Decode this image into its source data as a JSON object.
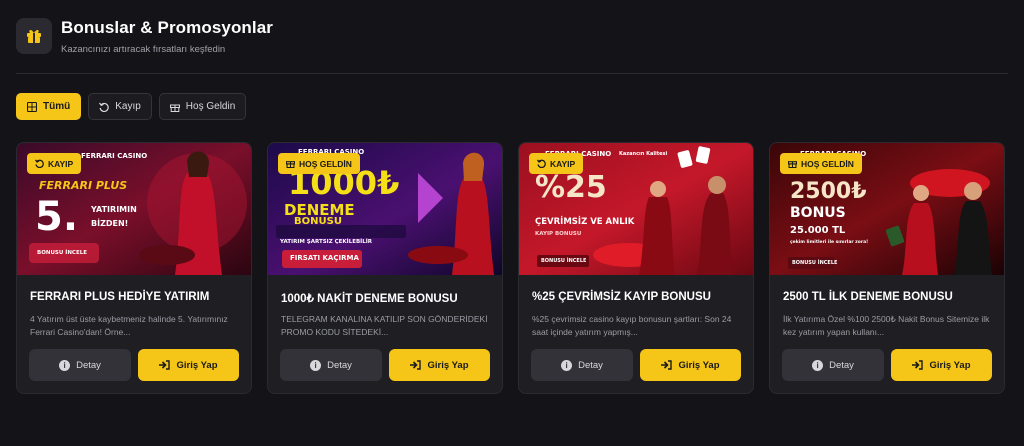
{
  "header": {
    "icon": "gift-icon",
    "title": "Bonuslar & Promosyonlar",
    "subtitle": "Kazancınızı artıracak fırsatları keşfedin"
  },
  "filters": [
    {
      "label": "Tümü",
      "icon": "grid-icon",
      "active": true
    },
    {
      "label": "Kayıp",
      "icon": "refresh-icon",
      "active": false
    },
    {
      "label": "Hoş Geldin",
      "icon": "gift-icon",
      "active": false
    }
  ],
  "colors": {
    "accent": "#f5c518",
    "background": "#141418",
    "card": "#1e1e23"
  },
  "cards": [
    {
      "badge": "KAYIP",
      "badge_icon": "refresh-icon",
      "title": "FERRARI PLUS HEDİYE YATIRIM",
      "description": "4 Yatırım üst üste kaybetmeniz halinde 5. Yatırımınız Ferrari Casino'dan! Örne...",
      "detail_label": "Detay",
      "login_label": "Giriş Yap",
      "banner": {
        "brand": "FERRARI CASINO",
        "line1": "FERRARI PLUS",
        "big": "5.",
        "line2": "YATIRIMIN",
        "line3": "BİZDEN!",
        "cta": "BONUSU İNCELE"
      }
    },
    {
      "badge": "HOŞ GELDİN",
      "badge_icon": "gift-icon",
      "title": "1000₺ NAKİT DENEME BONUSU",
      "description": "TELEGRAM KANALINA KATILIP SON GÖNDERİDEKİ PROMO KODU SİTEDEKİ...",
      "detail_label": "Detay",
      "login_label": "Giriş Yap",
      "banner": {
        "brand": "FERRARI CASINO",
        "big": "1000₺",
        "line1": "DENEME",
        "line2": "BONUSU",
        "line3": "YATIRIM ŞARTSIZ ÇEKİLEBİLİR",
        "cta": "FIRSATI KAÇIRMA"
      }
    },
    {
      "badge": "KAYIP",
      "badge_icon": "refresh-icon",
      "title": "%25 ÇEVRİMSİZ KAYIP BONUSU",
      "description": "%25 çevrimsiz casino kayıp bonusun şartları: Son 24 saat içinde yatırım yapmış...",
      "detail_label": "Detay",
      "login_label": "Giriş Yap",
      "banner": {
        "brand": "FERRARI CASINO",
        "tag": "Kazancın Kalitesi",
        "big": "%25",
        "line1": "ÇEVRİMSİZ VE ANLIK",
        "line2": "KAYIP BONUSU",
        "cta": "BONUSU İNCELE"
      }
    },
    {
      "badge": "HOŞ GELDİN",
      "badge_icon": "gift-icon",
      "title": "2500 TL İLK DENEME BONUSU",
      "description": "İlk Yatırıma Özel %100 2500₺ Nakit Bonus Sitemize ilk kez yatırım yapan kullanı...",
      "detail_label": "Detay",
      "login_label": "Giriş Yap",
      "banner": {
        "brand": "FERRARI CASINO",
        "big": "2500₺",
        "line1": "BONUS",
        "line2": "25.000 TL",
        "line3": "çekim limitleri ile sınırlar zora!",
        "cta": "BONUSU İNCELE"
      }
    }
  ]
}
